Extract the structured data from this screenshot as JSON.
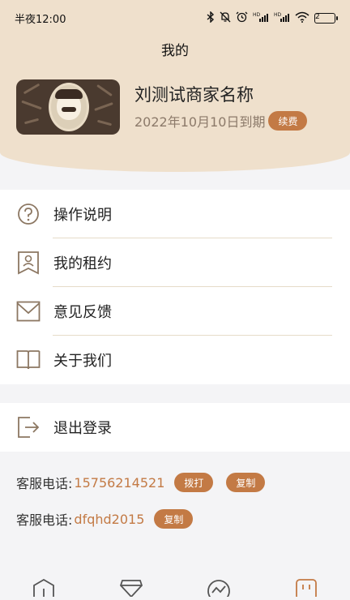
{
  "status_bar": {
    "time": "半夜12:00",
    "battery": "2"
  },
  "page": {
    "title": "我的"
  },
  "profile": {
    "shop_name": "刘测试商家名称",
    "expire_text": "2022年10月10日到期",
    "renew_label": "续费"
  },
  "menu": {
    "items": [
      {
        "label": "操作说明",
        "icon": "question-circle-icon"
      },
      {
        "label": "我的租约",
        "icon": "id-card-icon"
      },
      {
        "label": "意见反馈",
        "icon": "mail-icon"
      },
      {
        "label": "关于我们",
        "icon": "book-icon"
      }
    ],
    "logout_label": "退出登录"
  },
  "contact": [
    {
      "label": "客服电话:",
      "value": "15756214521",
      "buttons": [
        "拨打",
        "复制"
      ]
    },
    {
      "label": "客服电话:",
      "value": "dfqhd2015",
      "buttons": [
        "复制"
      ]
    }
  ],
  "colors": {
    "accent": "#c37a45",
    "header_bg": "#efe0cc",
    "icon": "#8c7762"
  },
  "tabbar": {
    "icons": [
      "home-icon",
      "diamond-icon",
      "chart-icon",
      "profile-icon"
    ],
    "active": 3
  }
}
